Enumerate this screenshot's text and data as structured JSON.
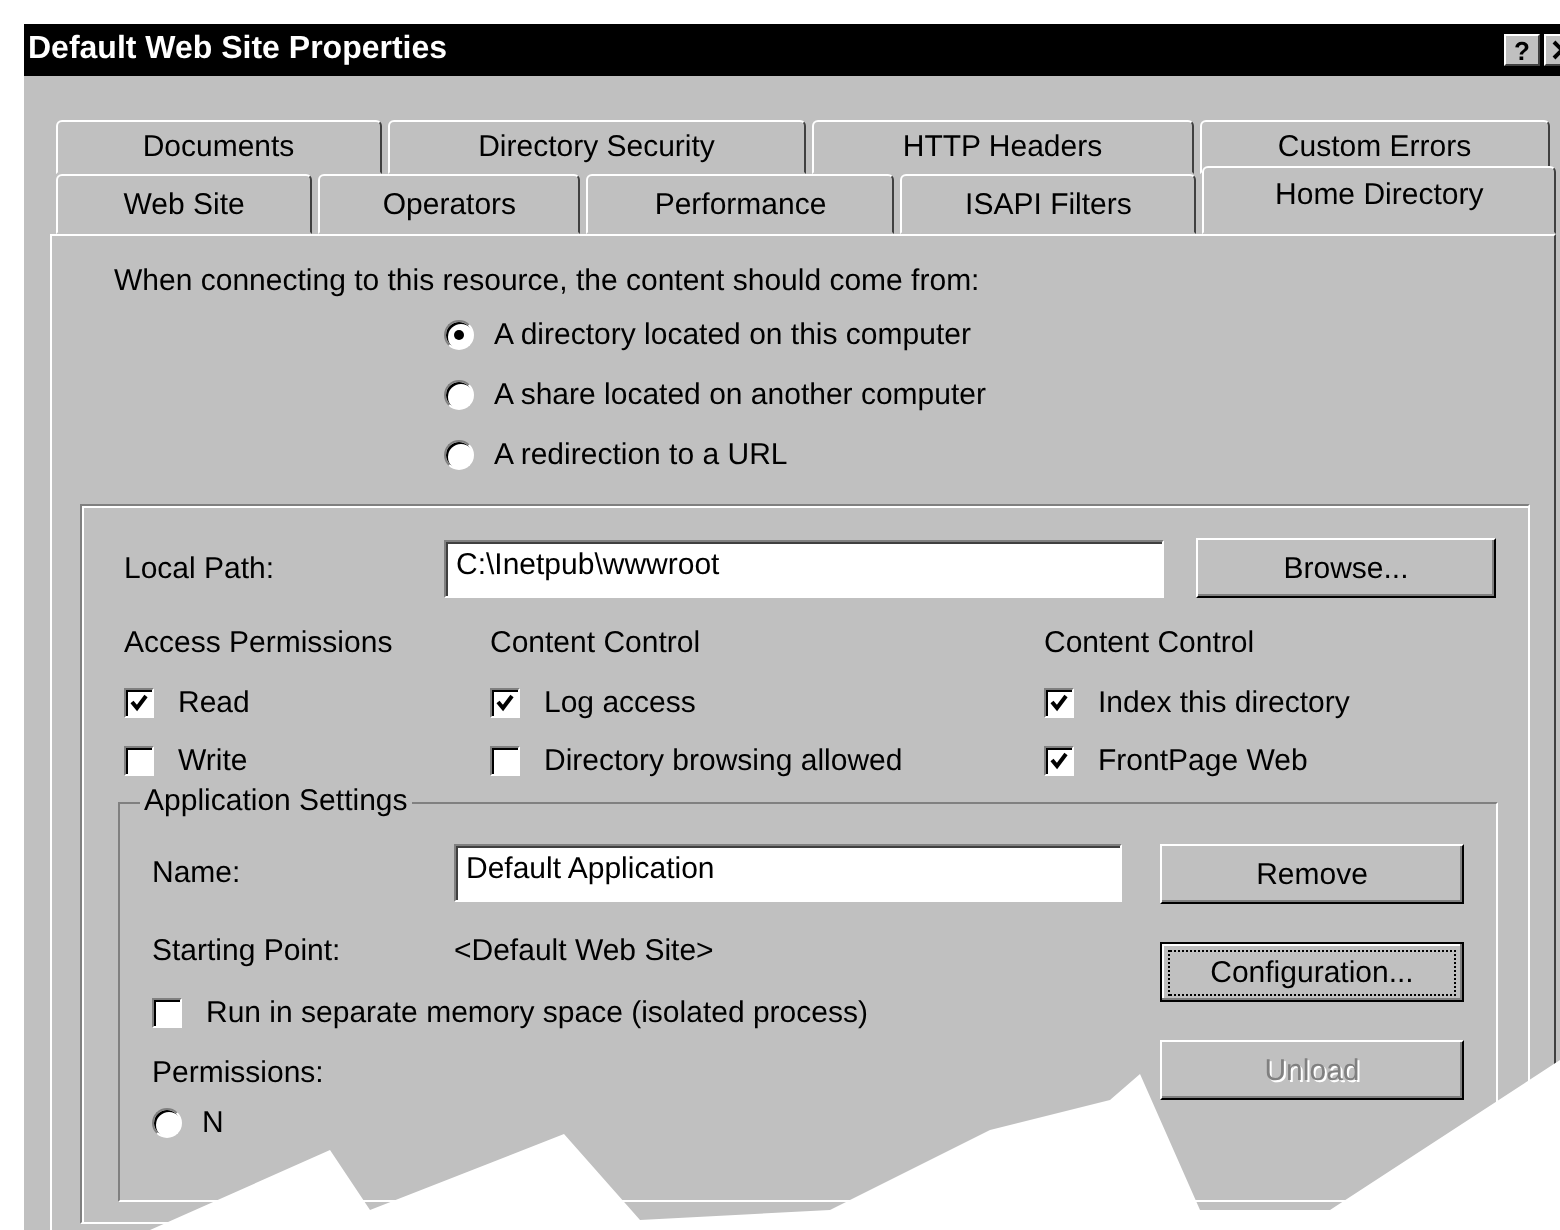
{
  "window": {
    "title": "Default Web Site Properties",
    "help_button": "?"
  },
  "tab_rows": [
    [
      {
        "label": "Documents",
        "selected": false
      },
      {
        "label": "Directory Security",
        "selected": false
      },
      {
        "label": "HTTP Headers",
        "selected": false
      },
      {
        "label": "Custom Errors",
        "selected": false
      }
    ],
    [
      {
        "label": "Web Site",
        "selected": false
      },
      {
        "label": "Operators",
        "selected": false
      },
      {
        "label": "Performance",
        "selected": false
      },
      {
        "label": "ISAPI Filters",
        "selected": false
      },
      {
        "label": "Home Directory",
        "selected": true
      }
    ]
  ],
  "source": {
    "prompt": "When connecting to this resource, the content should come from:",
    "options": [
      {
        "label": "A directory located on this computer",
        "selected": true
      },
      {
        "label": "A share located on another computer",
        "selected": false
      },
      {
        "label": "A redirection to a URL",
        "selected": false
      }
    ]
  },
  "local_path": {
    "label": "Local Path:",
    "value": "C:\\Inetpub\\wwwroot",
    "button": "Browse..."
  },
  "option_groups": [
    {
      "title": "Access Permissions",
      "items": [
        {
          "label": "Read",
          "checked": true
        },
        {
          "label": "Write",
          "checked": false
        }
      ]
    },
    {
      "title": "Content Control",
      "items": [
        {
          "label": "Log access",
          "checked": true
        },
        {
          "label": "Directory browsing allowed",
          "checked": false
        }
      ]
    },
    {
      "title": "Content Control",
      "items": [
        {
          "label": "Index this directory",
          "checked": true
        },
        {
          "label": "FrontPage Web",
          "checked": true
        }
      ]
    }
  ],
  "application_settings": {
    "title": "Application Settings",
    "name": {
      "label": "Name:",
      "value": "Default Application"
    },
    "starting_point": {
      "label": "Starting Point:",
      "value": "<Default Web Site>"
    },
    "isolated": {
      "label": "Run in separate memory space (isolated process)",
      "checked": false
    },
    "permissions_label": "Permissions:",
    "permission_options": [
      {
        "label": "N",
        "selected": false
      }
    ],
    "buttons": [
      {
        "label": "Remove",
        "disabled": false,
        "focused": false
      },
      {
        "label": "Configuration...",
        "disabled": false,
        "focused": true
      },
      {
        "label": "Unload",
        "disabled": true,
        "focused": false
      }
    ]
  }
}
